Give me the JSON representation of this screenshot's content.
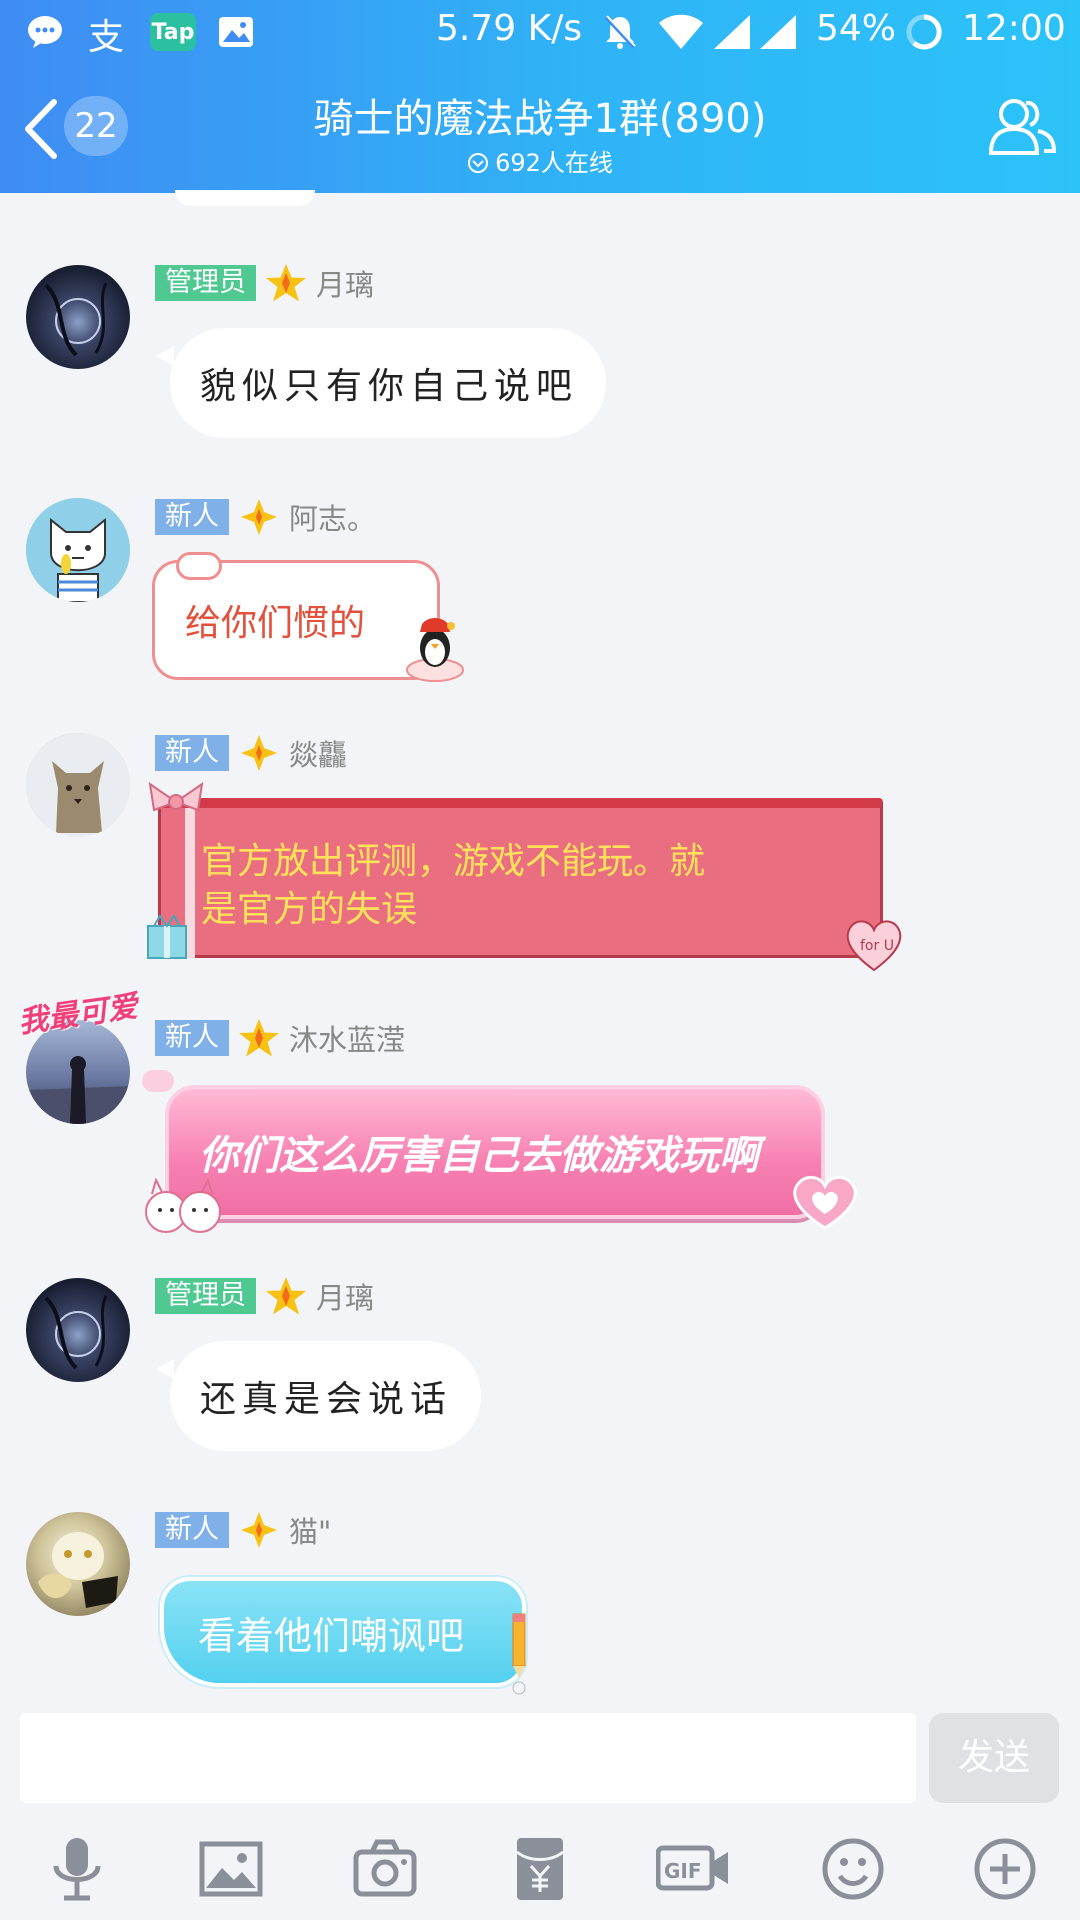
{
  "status_bar": {
    "speed": "5.79 K/s",
    "battery": "54%",
    "time": "12:00",
    "app_badge": "Tap",
    "app2": "支"
  },
  "header": {
    "title": "骑士的魔法战争1群(890)",
    "online": "692人在线",
    "unread_count": "22"
  },
  "messages": [
    {
      "role": "管理员",
      "name": "月璃",
      "text": "貌似只有你自己说吧",
      "style": "plain"
    },
    {
      "role": "新人",
      "name": "阿志。",
      "text": "给你们惯的",
      "style": "cloud"
    },
    {
      "role": "新人",
      "name": "燚龘",
      "text1": "官方放出评测，游戏不能玩。就",
      "text2": "是官方的失误",
      "style": "gift-red",
      "heart_text": "for U"
    },
    {
      "role": "新人",
      "name": "沐水蓝滢",
      "text": "你们这么厉害自己去做游戏玩啊",
      "style": "pink",
      "avatar_sticker": "我最可爱"
    },
    {
      "role": "管理员",
      "name": "月璃",
      "text": "还真是会说话",
      "style": "plain"
    },
    {
      "role": "新人",
      "name": "猫\"",
      "text": "看着他们嘲讽吧",
      "style": "blue"
    }
  ],
  "input": {
    "placeholder": "",
    "send_label": "发送"
  },
  "toolbar": [
    "mic-icon",
    "image-icon",
    "camera-icon",
    "red-packet-icon",
    "gif-icon",
    "emoji-icon",
    "plus-icon"
  ],
  "colors": {
    "header_start": "#3f8cf3",
    "header_end": "#2cc3f8",
    "admin_tag": "#4fc991",
    "new_tag": "#7fb0e8",
    "bubble_red": "#e96f80",
    "bubble_pink": "#f68bb9"
  }
}
